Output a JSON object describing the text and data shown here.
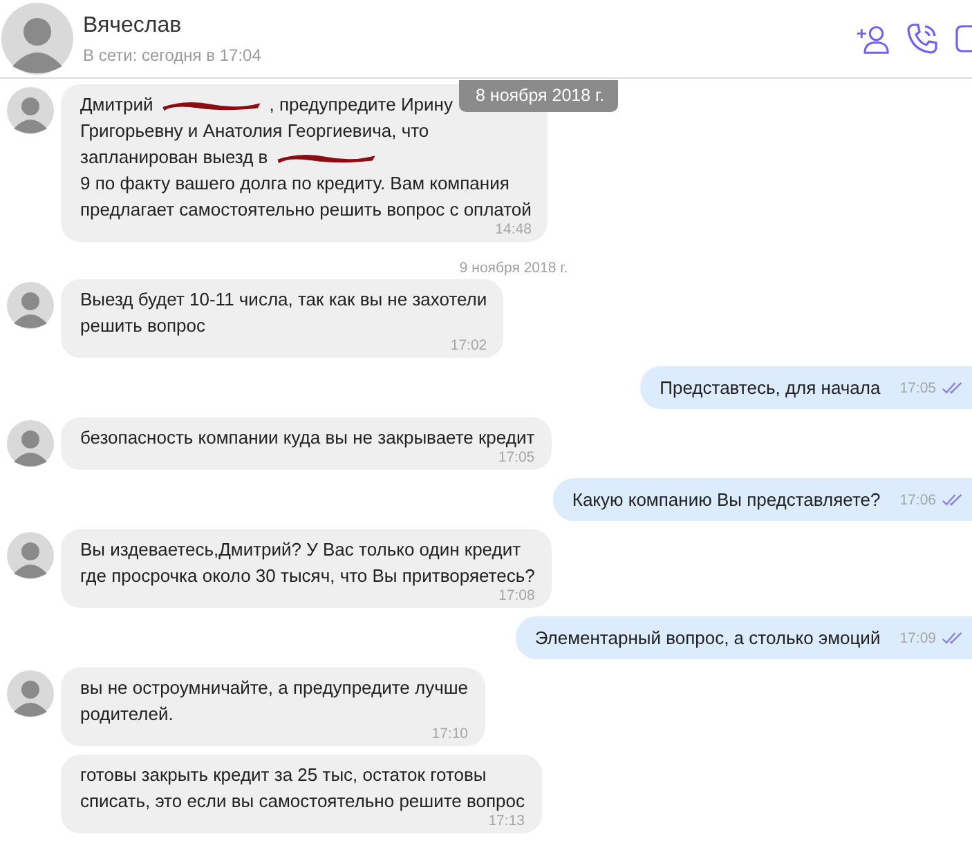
{
  "header": {
    "name": "Вячеслав",
    "status": "В сети: сегодня в 17:04"
  },
  "floating_date": "8 ноября 2018 г.",
  "messages": [
    {
      "kind": "incoming",
      "show_avatar": true,
      "lines": [
        [
          {
            "kind": "text",
            "text": "Дмитрий"
          },
          {
            "kind": "redaction"
          },
          {
            "kind": "text",
            "text": ", предупредите Ирину"
          }
        ],
        [
          {
            "kind": "text",
            "text": "Григорьевну и Анатолия Георгиевича, что"
          }
        ],
        [
          {
            "kind": "text",
            "text": "запланирован выезд в"
          },
          {
            "kind": "redaction"
          }
        ],
        [
          {
            "kind": "text",
            "text": "9 по факту вашего долга по кредиту. Вам компания"
          }
        ],
        [
          {
            "kind": "text",
            "text": "предлагает самостоятельно решить вопрос с оплатой"
          }
        ]
      ],
      "time": "14:48"
    },
    {
      "kind": "date",
      "text": "9 ноября 2018 г."
    },
    {
      "kind": "incoming",
      "show_avatar": true,
      "text": "Выезд будет 10-11 числа, так как вы не захотели\nрешить вопрос",
      "time": "17:02"
    },
    {
      "kind": "outgoing",
      "text": "Представтесь, для начала",
      "time": "17:05"
    },
    {
      "kind": "incoming",
      "show_avatar": true,
      "text": "безопасность компании куда вы не закрываете кредит",
      "time": "17:05"
    },
    {
      "kind": "outgoing",
      "text": "Какую компанию Вы представляете?",
      "time": "17:06"
    },
    {
      "kind": "incoming",
      "show_avatar": true,
      "text": "Вы издеваетесь,Дмитрий? У Вас только один кредит\nгде просрочка около 30 тысяч, что Вы притворяетесь?",
      "time": "17:08"
    },
    {
      "kind": "outgoing",
      "text": "Элементарный вопрос, а столько эмоций",
      "time": "17:09"
    },
    {
      "kind": "incoming",
      "show_avatar": true,
      "text": "вы не остроумничайте, а предупредите лучше\nродителей.",
      "time": "17:10"
    },
    {
      "kind": "incoming",
      "show_avatar": false,
      "text": "готовы закрыть кредит за 25 тыс, остаток готовы\nсписать, это если вы самостоятельно решите вопрос",
      "time": "17:13"
    }
  ]
}
